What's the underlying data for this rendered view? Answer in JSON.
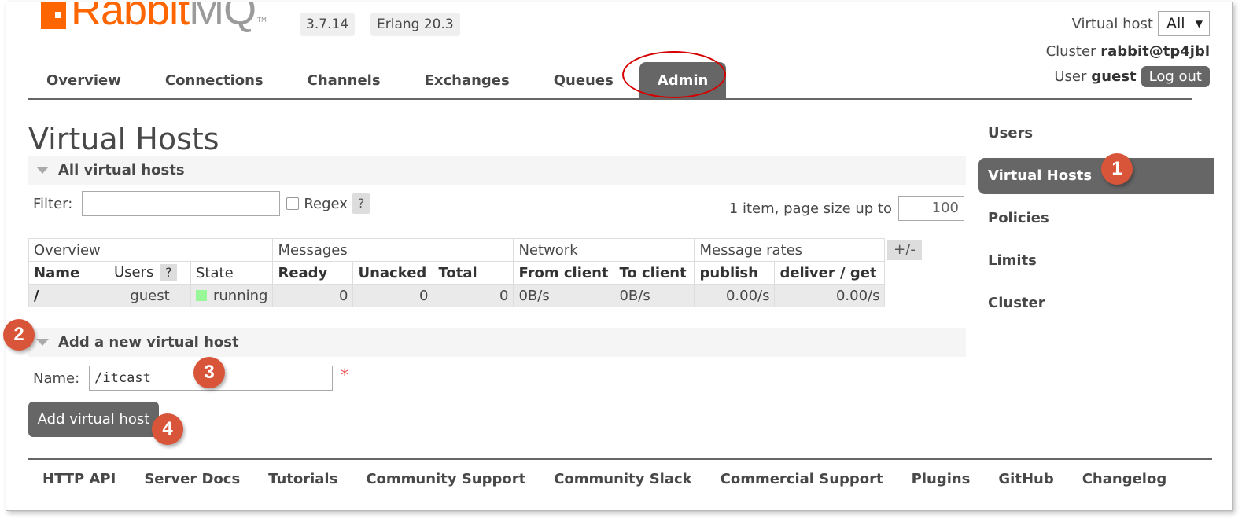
{
  "header": {
    "logo_text_rabbit": "Rabbit",
    "logo_text_mq": "MQ",
    "logo_tm": "TM",
    "version": "3.7.14",
    "erlang": "Erlang 20.3",
    "virtual_host_label": "Virtual host",
    "virtual_host_value": "All",
    "cluster_label": "Cluster",
    "cluster_value": "rabbit@tp4jbl",
    "user_label": "User",
    "user_value": "guest",
    "logout_label": "Log out"
  },
  "nav": {
    "tabs": [
      "Overview",
      "Connections",
      "Channels",
      "Exchanges",
      "Queues",
      "Admin"
    ],
    "active": "Admin"
  },
  "main": {
    "title": "Virtual Hosts",
    "all_section_title": "All virtual hosts",
    "filter_label": "Filter:",
    "filter_value": "",
    "regex_label": "Regex",
    "help": "?",
    "paging_text": "1 item, page size up to",
    "page_size": "100",
    "table": {
      "groups": [
        "Overview",
        "Messages",
        "Network",
        "Message rates"
      ],
      "columns": [
        "Name",
        "Users",
        "State",
        "Ready",
        "Unacked",
        "Total",
        "From client",
        "To client",
        "publish",
        "deliver / get"
      ],
      "rows": [
        {
          "name": "/",
          "users": "guest",
          "state": "running",
          "ready": "0",
          "unacked": "0",
          "total": "0",
          "from_client": "0B/s",
          "to_client": "0B/s",
          "publish": "0.00/s",
          "deliver_get": "0.00/s"
        }
      ],
      "plusminus": "+/-"
    },
    "add_section_title": "Add a new virtual host",
    "name_label": "Name:",
    "name_value": "/itcast",
    "required_mark": "*",
    "add_button": "Add virtual host"
  },
  "sidebar": {
    "items": [
      "Users",
      "Virtual Hosts",
      "Policies",
      "Limits",
      "Cluster"
    ],
    "active": "Virtual Hosts"
  },
  "footer": {
    "links": [
      "HTTP API",
      "Server Docs",
      "Tutorials",
      "Community Support",
      "Community Slack",
      "Commercial Support",
      "Plugins",
      "GitHub",
      "Changelog"
    ]
  },
  "callouts": [
    "1",
    "2",
    "3",
    "4"
  ],
  "colors": {
    "accent_orange": "#ff6600",
    "tab_active": "#666666",
    "callout": "#d9553a",
    "annotation_circle": "#d60000",
    "state_running": "#98f898"
  }
}
